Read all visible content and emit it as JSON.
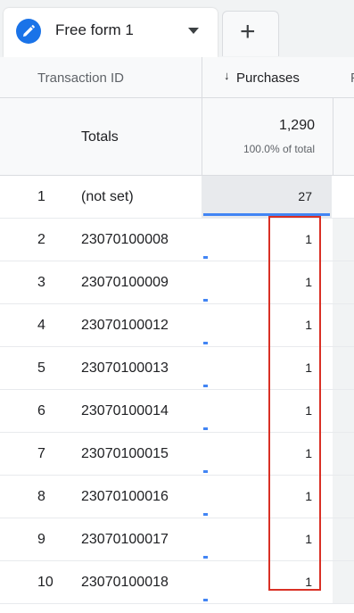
{
  "tab": {
    "label": "Free form 1",
    "icon": "pencil-icon",
    "accent": "#1a73e8"
  },
  "add_tab": {
    "label": "+"
  },
  "table": {
    "columns": {
      "dimension": "Transaction ID",
      "metric": "Purchases",
      "next_partial": "F",
      "sort_indicator": "↓"
    },
    "totals": {
      "label": "Totals",
      "value": "1,290",
      "percent": "100.0% of total"
    },
    "rows": [
      {
        "index": "1",
        "id": "(not set)",
        "value": "27"
      },
      {
        "index": "2",
        "id": "23070100008",
        "value": "1"
      },
      {
        "index": "3",
        "id": "23070100009",
        "value": "1"
      },
      {
        "index": "4",
        "id": "23070100012",
        "value": "1"
      },
      {
        "index": "5",
        "id": "23070100013",
        "value": "1"
      },
      {
        "index": "6",
        "id": "23070100014",
        "value": "1"
      },
      {
        "index": "7",
        "id": "23070100015",
        "value": "1"
      },
      {
        "index": "8",
        "id": "23070100016",
        "value": "1"
      },
      {
        "index": "9",
        "id": "23070100017",
        "value": "1"
      },
      {
        "index": "10",
        "id": "23070100018",
        "value": "1"
      }
    ]
  },
  "colors": {
    "bar": "#4285f4",
    "highlight": "#d93025"
  }
}
